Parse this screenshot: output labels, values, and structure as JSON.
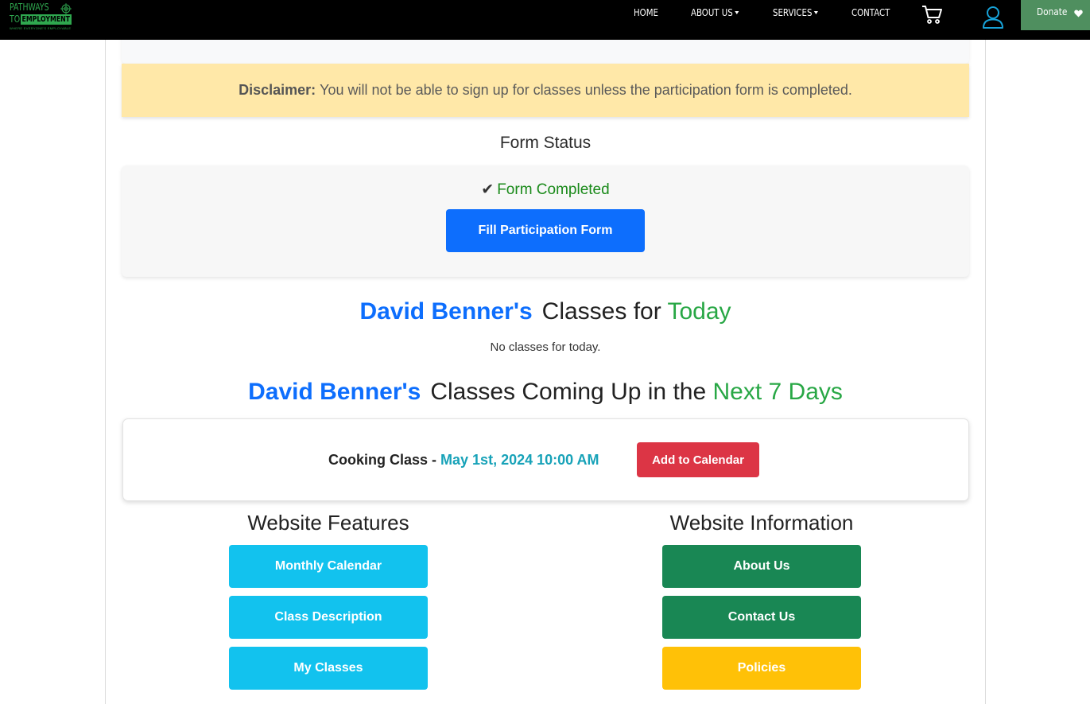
{
  "nav": {
    "logo": {
      "line1": "PATHWAYS",
      "line2a": "TO",
      "line2b": "EMPLOYMENT",
      "tagline": "WHERE EVERYONE'S EMPLOYABLE"
    },
    "links": [
      {
        "label": "HOME"
      },
      {
        "label": "ABOUT US"
      },
      {
        "label": "SERVICES"
      },
      {
        "label": "CONTACT"
      }
    ],
    "cart_icon": "cart-icon",
    "user_icon": "user-icon",
    "donate_label": "Donate",
    "donate_icon": "heart-icon"
  },
  "disclaimer": {
    "label": "Disclaimer:",
    "text": "You will not be able to sign up for classes unless the participation form is completed."
  },
  "form_status": {
    "title": "Form Status",
    "check": "✔",
    "status_text": "Form Completed",
    "button_label": "Fill Participation Form"
  },
  "today": {
    "name": "David Benner's",
    "middle": "Classes for",
    "highlight": "Today",
    "empty_text": "No classes for today."
  },
  "upcoming": {
    "name": "David Benner's",
    "middle": "Classes Coming Up in the",
    "highlight": "Next 7 Days",
    "classes": [
      {
        "name": "Cooking Class - ",
        "datetime": "May 1st, 2024 10:00 AM",
        "button_label": "Add to Calendar"
      }
    ]
  },
  "features": {
    "title": "Website Features",
    "buttons": [
      {
        "label": "Monthly Calendar"
      },
      {
        "label": "Class Description"
      },
      {
        "label": "My Classes"
      }
    ]
  },
  "information": {
    "title": "Website Information",
    "buttons": [
      {
        "label": "About Us"
      },
      {
        "label": "Contact Us"
      },
      {
        "label": "Policies"
      }
    ]
  },
  "colors": {
    "primary": "#0d6efd",
    "success": "#28a745",
    "danger": "#dc3545",
    "info": "#12c2ee",
    "dark_green": "#198754",
    "warning": "#ffc107",
    "disclaimer_bg": "#ffe8a8"
  }
}
